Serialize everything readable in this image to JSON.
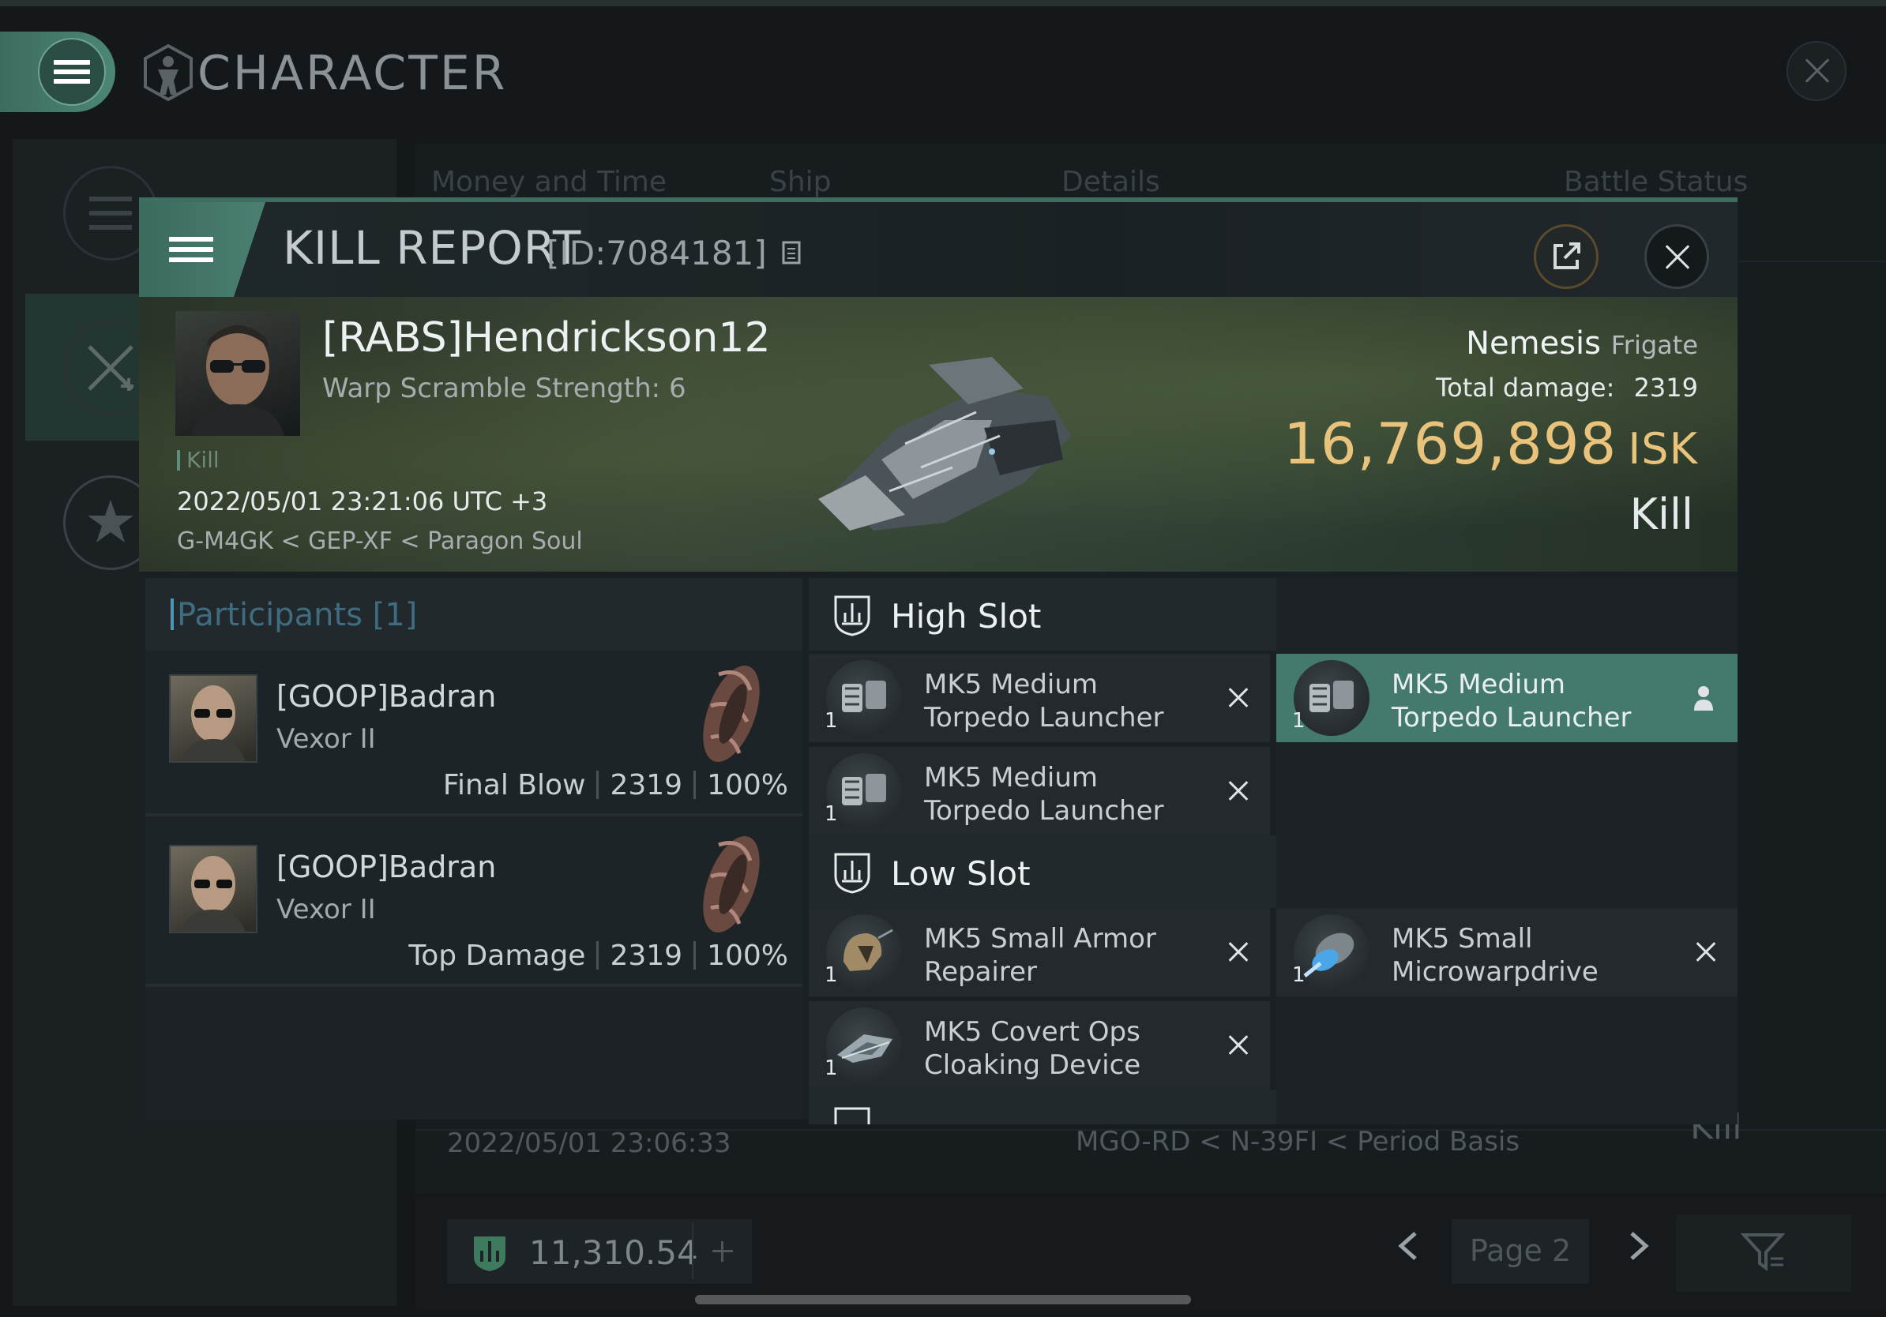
{
  "app": {
    "title": "CHARACTER"
  },
  "background_table": {
    "headers": [
      "Money and Time",
      "Ship",
      "Details",
      "Battle Status"
    ],
    "partial_row": {
      "date": "2022/05/01  23:06:33",
      "location": "MGO-RD < N-39FI < Period Basis",
      "status": "Kill"
    }
  },
  "bottom_bar": {
    "wallet_amount": "11,310.54",
    "page_label": "Page 2"
  },
  "kill_report": {
    "title": "KILL REPORT",
    "id_label": "[ID:7084181]",
    "victim": {
      "name": "[RABS]Hendrickson12",
      "subtitle": "Warp Scramble Strength: 6",
      "tag": "Kill",
      "datetime": "2022/05/01 23:21:06 UTC +3",
      "location": "G-M4GK < GEP-XF < Paragon Soul",
      "ship_name": "Nemesis",
      "ship_class": "Frigate",
      "total_damage_label": "Total damage:",
      "total_damage_value": "2319",
      "isk_value": "16,769,898",
      "isk_unit": "ISK",
      "result": "Kill"
    },
    "participants": {
      "header": "Participants [1]",
      "rows": [
        {
          "name": "[GOOP]Badran",
          "ship": "Vexor II",
          "role": "Final Blow",
          "damage": "2319",
          "percent": "100%"
        },
        {
          "name": "[GOOP]Badran",
          "ship": "Vexor II",
          "role": "Top Damage",
          "damage": "2319",
          "percent": "100%"
        }
      ]
    },
    "fitting": {
      "high_slot_label": "High Slot",
      "low_slot_label": "Low Slot",
      "high_slot": [
        {
          "qty": "1",
          "name_line1": "MK5 Medium",
          "name_line2": "Torpedo Launcher",
          "state": "destroyed"
        },
        {
          "qty": "1",
          "name_line1": "MK5 Medium",
          "name_line2": "Torpedo Launcher",
          "state": "dropped"
        },
        {
          "qty": "1",
          "name_line1": "MK5 Medium",
          "name_line2": "Torpedo Launcher",
          "state": "destroyed"
        }
      ],
      "low_slot": [
        {
          "qty": "1",
          "name_line1": "MK5 Small Armor",
          "name_line2": "Repairer",
          "state": "destroyed"
        },
        {
          "qty": "1",
          "name_line1": "MK5 Small",
          "name_line2": "Microwarpdrive",
          "state": "destroyed"
        },
        {
          "qty": "1",
          "name_line1": "MK5 Covert Ops",
          "name_line2": "Cloaking Device",
          "state": "destroyed"
        }
      ]
    }
  },
  "colors": {
    "accent_green": "#447a6d",
    "isk_gold": "#e9c37b",
    "participants_blue": "#4c97b3"
  },
  "icons": [
    "menu-icon",
    "character-icon",
    "close-icon",
    "external-link-icon",
    "copy-icon",
    "slot-icon",
    "close-x-icon",
    "person-icon",
    "wallet-icon",
    "filter-icon",
    "chevron-left-icon",
    "chevron-right-icon"
  ]
}
